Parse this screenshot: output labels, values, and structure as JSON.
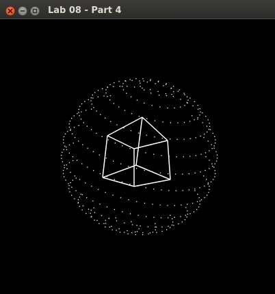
{
  "window": {
    "title": "Lab 08 - Part 4",
    "background": "#000000"
  },
  "controls": [
    {
      "name": "close-button",
      "icon": "close-icon"
    },
    {
      "name": "minimize-button",
      "icon": "minimize-icon"
    },
    {
      "name": "maximize-button",
      "icon": "maximize-icon"
    }
  ],
  "scene": {
    "objects": [
      "dotted-sphere",
      "wireframe-cube"
    ],
    "stroke_color": "#ffffff"
  }
}
